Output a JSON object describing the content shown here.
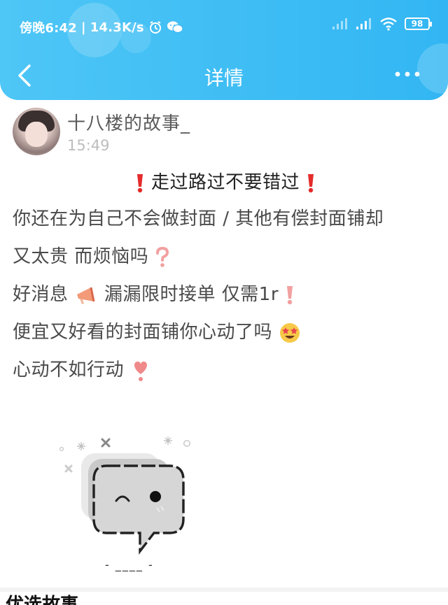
{
  "status_bar": {
    "time": "傍晚6:42",
    "network_speed": "14.3K/s",
    "separator": "|",
    "battery": "98"
  },
  "nav": {
    "title": "详情"
  },
  "post": {
    "author": "十八楼的故事_",
    "time": "15:49",
    "lines": [
      "走过路过不要错过",
      "你还在为自己不会做封面 / 其他有偿封面铺却",
      "又太贵 而烦恼吗",
      "好消息",
      "漏漏限时接单 仅需1r",
      "便宜又好看的封面铺你心动了吗",
      "心动不如行动"
    ],
    "image_placeholder_text": "-  ____  -"
  },
  "bottom_section": {
    "title": "优选故事"
  },
  "colors": {
    "header_start": "#4ec6f6",
    "header_end": "#32b6f3",
    "exclamation_red": "#e52b2b",
    "question_pink": "#f2a0a0",
    "heart_pink": "#f08a8a"
  }
}
